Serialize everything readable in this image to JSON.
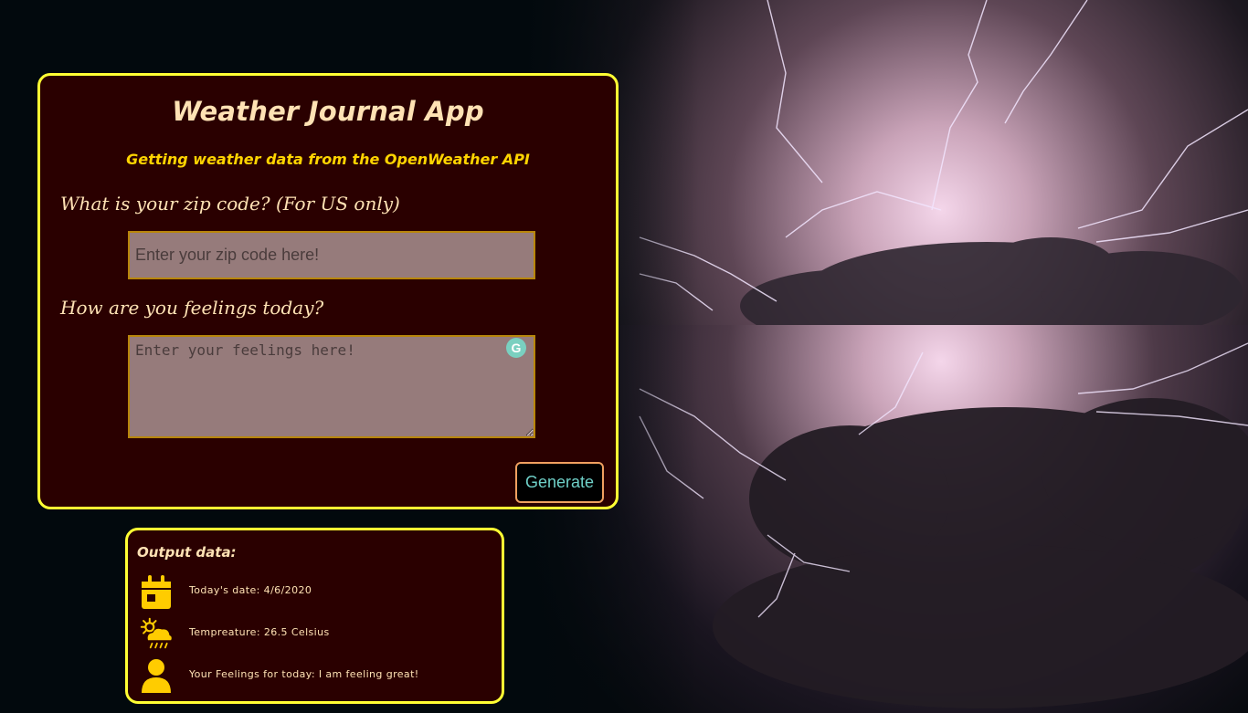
{
  "app": {
    "title": "Weather Journal App",
    "subtitle": "Getting weather data from the OpenWeather API"
  },
  "form": {
    "zip_label": "What is your zip code? (For US only)",
    "zip_placeholder": "Enter your zip code here!",
    "zip_value": "",
    "feelings_label": "How are you feelings today?",
    "feelings_placeholder": "Enter your feelings here!",
    "feelings_value": "",
    "generate_label": "Generate",
    "grammarly_icon": "G"
  },
  "output": {
    "title": "Output data:",
    "date_text": "Today's date: 4/6/2020",
    "temp_text": "Tempreature: 26.5 Celsius",
    "feelings_text": "Your Feelings for today: I am feeling great!",
    "icons": [
      "calendar-icon",
      "weather-sun-rain-icon",
      "user-icon"
    ]
  },
  "colors": {
    "card_bg": "#2a0000",
    "card_border": "#ffff33",
    "title": "#ffe2b4",
    "subtitle": "#ffd400",
    "icon": "#ffcc00",
    "input_bg": "#967b7b",
    "button_text": "#6fd0c8"
  }
}
